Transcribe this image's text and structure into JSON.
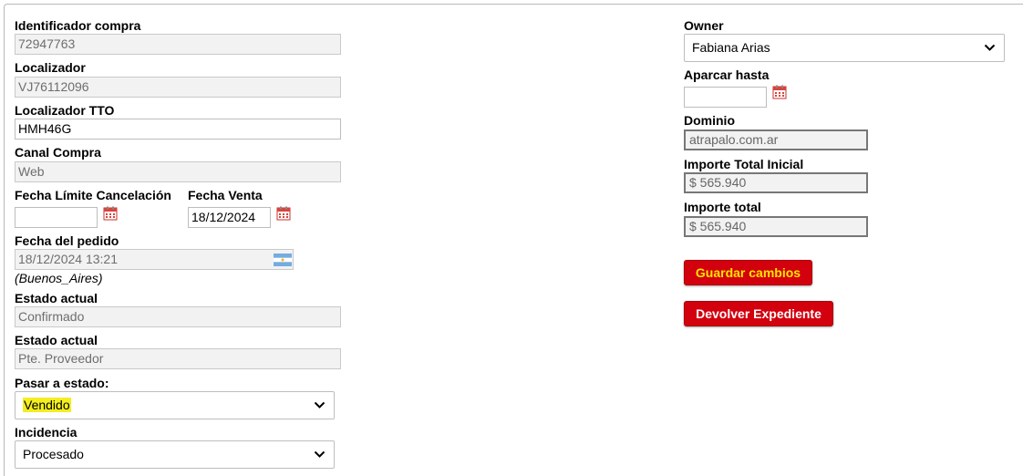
{
  "left": {
    "identificador": {
      "label": "Identificador compra",
      "value": "72947763"
    },
    "localizador": {
      "label": "Localizador",
      "value": "VJ76112096"
    },
    "localizador_tto": {
      "label": "Localizador TTO",
      "value": "HMH46G"
    },
    "canal": {
      "label": "Canal Compra",
      "value": "Web"
    },
    "fecha_limite": {
      "label": "Fecha Límite Cancelación",
      "value": ""
    },
    "fecha_venta": {
      "label": "Fecha Venta",
      "value": "18/12/2024"
    },
    "fecha_pedido": {
      "label": "Fecha del pedido",
      "value": "18/12/2024 13:21",
      "timezone": "(Buenos_Aires)"
    },
    "estado_actual_1": {
      "label": "Estado actual",
      "value": "Confirmado"
    },
    "estado_actual_2": {
      "label": "Estado actual",
      "value": "Pte. Proveedor"
    },
    "pasar_estado": {
      "label": "Pasar a estado:",
      "selected": "Vendido"
    },
    "incidencia": {
      "label": "Incidencia",
      "selected": "Procesado"
    }
  },
  "right": {
    "owner": {
      "label": "Owner",
      "selected": "Fabiana Arias"
    },
    "aparcar": {
      "label": "Aparcar hasta",
      "value": ""
    },
    "dominio": {
      "label": "Dominio",
      "value": "atrapalo.com.ar"
    },
    "importe_inicial": {
      "label": "Importe Total Inicial",
      "value": "$ 565.940"
    },
    "importe_total": {
      "label": "Importe total",
      "value": "$ 565.940"
    }
  },
  "buttons": {
    "guardar": "Guardar cambios",
    "devolver": "Devolver Expediente"
  },
  "colors": {
    "button_bg": "#d3000e",
    "guardar_text": "#ffe600",
    "devolver_text": "#ffffff",
    "highlight": "#f3ee21"
  },
  "icons": {
    "calendar": "calendar-icon",
    "flag": "argentina-flag-icon",
    "chevron": "chevron-down-icon"
  }
}
